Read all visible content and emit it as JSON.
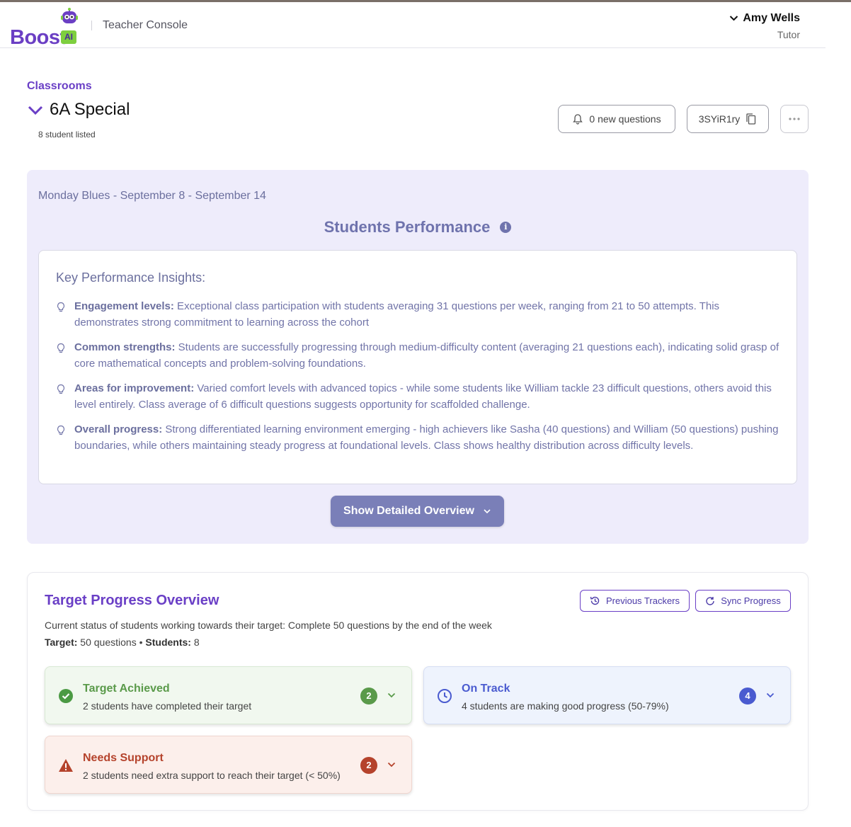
{
  "header": {
    "logo_text": "Boost",
    "logo_badge": "AI",
    "console_title": "Teacher Console",
    "user_name": "Amy Wells",
    "user_role": "Tutor",
    "icons": {
      "user_menu": "chevron-down-icon",
      "logo": "robot-icon"
    }
  },
  "classroom": {
    "breadcrumb": "Classrooms",
    "name": "6A Special",
    "student_count": "8 student listed",
    "questions_button": "0 new questions",
    "class_code": "3SYiR1ry",
    "icons": {
      "questions": "bell-icon",
      "code": "copy-icon",
      "more": "more-horizontal-icon"
    }
  },
  "performance": {
    "week_label": "Monday Blues - September 8 - September 14",
    "title": "Students Performance",
    "insights_title": "Key Performance Insights:",
    "insights": [
      {
        "label": "Engagement levels:",
        "text": " Exceptional class participation with students averaging 31 questions per week, ranging from 21 to 50 attempts. This demonstrates strong commitment to learning across the cohort"
      },
      {
        "label": "Common strengths:",
        "text": " Students are successfully progressing through medium-difficulty content (averaging 21 questions each), indicating solid grasp of core mathematical concepts and problem-solving foundations."
      },
      {
        "label": "Areas for improvement:",
        "text": " Varied comfort levels with advanced topics - while some students like William tackle 23 difficult questions, others avoid this level entirely. Class average of 6 difficult questions suggests opportunity for scaffolded challenge."
      },
      {
        "label": "Overall progress:",
        "text": " Strong differentiated learning environment emerging - high achievers like Sasha (40 questions) and William (50 questions) pushing boundaries, while others maintaining steady progress at foundational levels. Class shows healthy distribution across difficulty levels."
      }
    ],
    "overview_button": "Show Detailed Overview",
    "colors": {
      "panel_bg": "#eeecfb",
      "accent": "#6f73ad",
      "button": "#7a7fb8"
    }
  },
  "target": {
    "title": "Target Progress Overview",
    "previous_button": "Previous Trackers",
    "sync_button": "Sync Progress",
    "description": "Current status of students working towards their target: Complete 50 questions by the end of the week",
    "target_label": "Target:",
    "target_value": " 50 questions",
    "separator": " • ",
    "students_label": "Students:",
    "students_value": " 8",
    "cards": {
      "achieved": {
        "title": "Target Achieved",
        "subtitle": "2 students have completed their target",
        "count": "2",
        "color": "#5a9a4a"
      },
      "on_track": {
        "title": "On Track",
        "subtitle": "4 students are making good progress (50-79%)",
        "count": "4",
        "color": "#4a5bd0"
      },
      "needs_support": {
        "title": "Needs Support",
        "subtitle": "2 students need extra support to reach their target (< 50%)",
        "count": "2",
        "color": "#b5432c"
      }
    }
  }
}
